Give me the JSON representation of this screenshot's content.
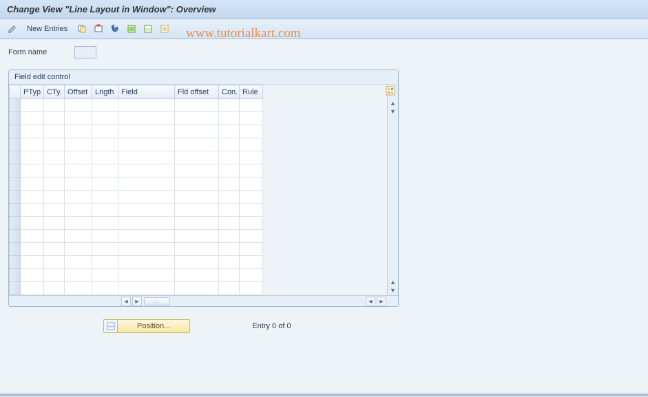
{
  "title": "Change View \"Line Layout in Window\": Overview",
  "toolbar": {
    "new_entries": "New Entries"
  },
  "form": {
    "name_label": "Form name",
    "name_value": ""
  },
  "panel": {
    "title": "Field edit control",
    "columns": {
      "ptyp": "PTyp",
      "cty": "CTy.",
      "offset": "Offset",
      "lngth": "Lngth",
      "field": "Field",
      "fld_offset": "Fld offset",
      "con": "Con.",
      "rule": "Rule"
    }
  },
  "footer": {
    "position_label": "Position...",
    "entry_status": "Entry 0 of 0"
  },
  "watermark": "www.tutorialkart.com"
}
